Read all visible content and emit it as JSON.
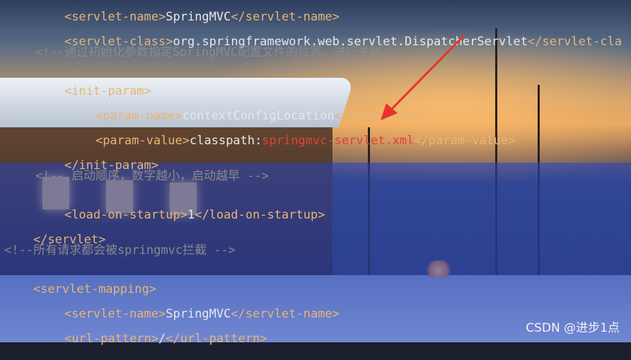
{
  "lines": [
    {
      "tag_open": "<servlet-name>",
      "text": "SpringMVC",
      "tag_close": "</servlet-name>"
    },
    {
      "tag_open": "<servlet-class>",
      "text": "org.springframework.web.servlet.DispatcherServlet",
      "tag_close": "</servlet-cla"
    },
    {
      "comment": "<!--通过初始化参数指定SpringMVC配置文件的位置，进行关联-->"
    },
    {
      "tag_open": "<init-param>"
    },
    {
      "tag_open": "<param-name>",
      "text": "contextConfigLocation",
      "tag_close": "</param-name>"
    },
    {
      "tag_open": "<param-value>",
      "text": "classpath:",
      "highlight": "springmvc-servlet.xml",
      "tag_close": "</param-value>"
    },
    {
      "tag_open": "</init-param>"
    },
    {
      "comment": "<!-- 启动顺序，数字越小，启动越早 -->"
    },
    {
      "tag_open": "<load-on-startup>",
      "text": "1",
      "tag_close": "</load-on-startup>"
    },
    {
      "tag_open": "</servlet>"
    },
    {
      "comment": "<!--所有请求都会被springmvc拦截 -->"
    },
    {
      "tag_open": "<servlet-mapping>"
    },
    {
      "tag_open": "<servlet-name>",
      "text": "SpringMVC",
      "tag_close": "</servlet-name>"
    },
    {
      "tag_open": "<url-pattern>",
      "text": "/",
      "tag_close": "</url-pattern>"
    }
  ],
  "watermark": "CSDN @进步1点",
  "colors": {
    "tag": "#e6b673",
    "text": "#e8e8e8",
    "comment": "#8a8a8a",
    "highlight": "#e0443a",
    "arrow": "#e8322a",
    "selection": "#2846be"
  }
}
